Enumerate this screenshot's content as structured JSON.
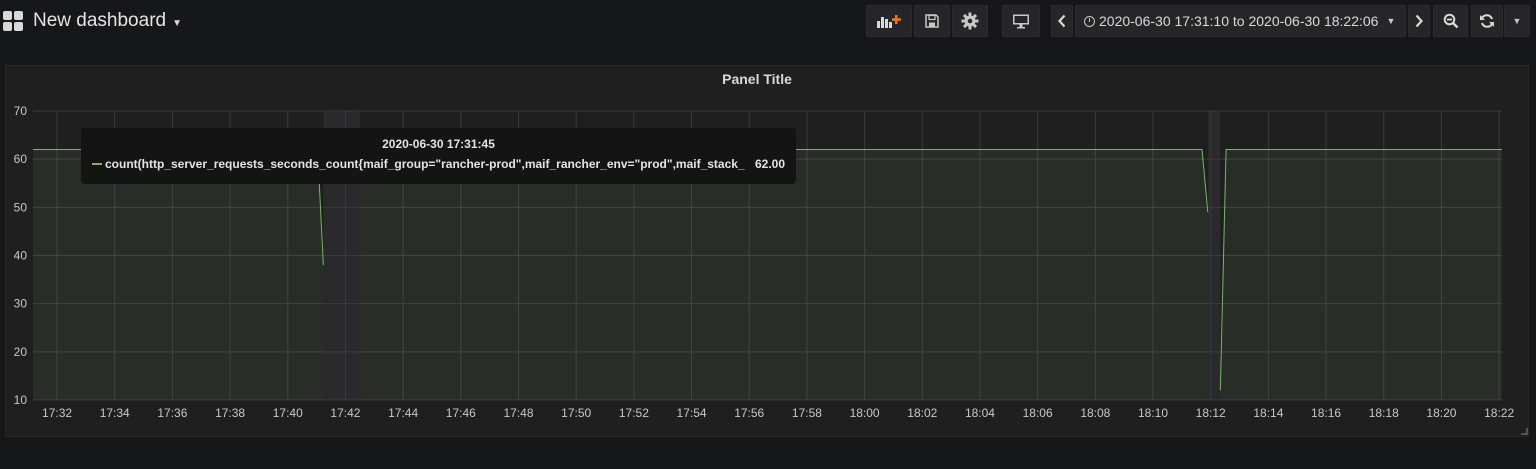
{
  "header": {
    "dashboard_title": "New dashboard",
    "time_range": "2020-06-30 17:31:10 to 2020-06-30 18:22:06",
    "icons": {
      "add_panel": "add-panel-icon",
      "save": "save-icon",
      "settings": "gear-icon",
      "cycle_view": "monitor-icon",
      "shift_back": "chevron-left-icon",
      "shift_forward": "chevron-right-icon",
      "zoom_out": "zoom-out-icon",
      "refresh": "refresh-icon",
      "refresh_dropdown": "caret-down-icon"
    }
  },
  "panel": {
    "title": "Panel Title"
  },
  "tooltip": {
    "time": "2020-06-30 17:31:45",
    "series_label": "count(http_server_requests_seconds_count{maif_group=\"rancher-prod\",maif_rancher_env=\"prod\",maif_stack_name=...",
    "value": "62.00"
  },
  "chart_data": {
    "type": "line",
    "title": "Panel Title",
    "xlabel": "",
    "ylabel": "",
    "ylim": [
      10,
      70
    ],
    "y_ticks": [
      "10",
      "20",
      "30",
      "40",
      "50",
      "60",
      "70"
    ],
    "x_ticks": [
      "17:32",
      "17:34",
      "17:36",
      "17:38",
      "17:40",
      "17:42",
      "17:44",
      "17:46",
      "17:48",
      "17:50",
      "17:52",
      "17:54",
      "17:56",
      "17:58",
      "18:00",
      "18:02",
      "18:04",
      "18:06",
      "18:08",
      "18:10",
      "18:12",
      "18:14",
      "18:16",
      "18:18",
      "18:20",
      "18:22"
    ],
    "grid": true,
    "color": "#7eb26d",
    "series": [
      {
        "segments": [
          [
            [
              "17:31:10",
              62
            ],
            [
              "17:41:02",
              62
            ],
            [
              "17:41:14",
              38
            ]
          ],
          [
            [
              "17:42:31",
              62
            ],
            [
              "18:11:42",
              62
            ],
            [
              "18:11:54",
              49
            ]
          ],
          [
            [
              "18:12:20",
              12
            ],
            [
              "18:12:32",
              62
            ],
            [
              "18:22:06",
              62
            ]
          ]
        ]
      }
    ]
  }
}
